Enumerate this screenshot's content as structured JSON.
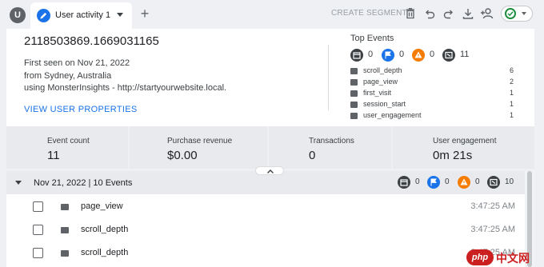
{
  "tabbar": {
    "avatar_letter": "U",
    "tab_label": "User activity 1",
    "add_tab_symbol": "+",
    "create_segment_label": "CREATE SEGMENT",
    "tool_icons": [
      "delete-icon",
      "undo-icon",
      "redo-icon",
      "download-icon",
      "add-user-icon"
    ],
    "status_icon": "check-circle-icon"
  },
  "profile": {
    "user_id": "2118503869.1669031165",
    "first_seen": "First seen on Nov 21, 2022",
    "location": "from Sydney, Australia",
    "source": "using MonsterInsights - http://startyourwebsite.local.",
    "view_properties_label": "VIEW USER PROPERTIES"
  },
  "top_events": {
    "title": "Top Events",
    "categories": [
      {
        "icon": "calendar-icon",
        "color": "#3c4043",
        "count": "0"
      },
      {
        "icon": "flag-icon",
        "color": "#1a73e8",
        "count": "0"
      },
      {
        "icon": "warning-icon",
        "color": "#f57c00",
        "count": "0"
      },
      {
        "icon": "event-icon",
        "color": "#3c4043",
        "count": "11"
      }
    ],
    "events": [
      {
        "name": "scroll_depth",
        "count": "6"
      },
      {
        "name": "page_view",
        "count": "2"
      },
      {
        "name": "first_visit",
        "count": "1"
      },
      {
        "name": "session_start",
        "count": "1"
      },
      {
        "name": "user_engagement",
        "count": "1"
      }
    ]
  },
  "metrics": [
    {
      "label": "Event count",
      "value": "11"
    },
    {
      "label": "Purchase revenue",
      "value": "$0.00"
    },
    {
      "label": "Transactions",
      "value": "0"
    },
    {
      "label": "User engagement",
      "value": "0m 21s"
    }
  ],
  "log": {
    "header": "Nov 21, 2022 | 10 Events",
    "categories": [
      {
        "icon": "calendar-icon",
        "color": "#3c4043",
        "count": "0"
      },
      {
        "icon": "flag-icon",
        "color": "#1a73e8",
        "count": "0"
      },
      {
        "icon": "warning-icon",
        "color": "#f57c00",
        "count": "0"
      },
      {
        "icon": "event-icon",
        "color": "#3c4043",
        "count": "10"
      }
    ],
    "rows": [
      {
        "name": "page_view",
        "time": "3:47:25 AM"
      },
      {
        "name": "scroll_depth",
        "time": "3:47:25 AM"
      },
      {
        "name": "scroll_depth",
        "time": "3:47:25 AM"
      }
    ]
  },
  "watermark": {
    "logo_text": "php",
    "site_text": "中文网"
  }
}
